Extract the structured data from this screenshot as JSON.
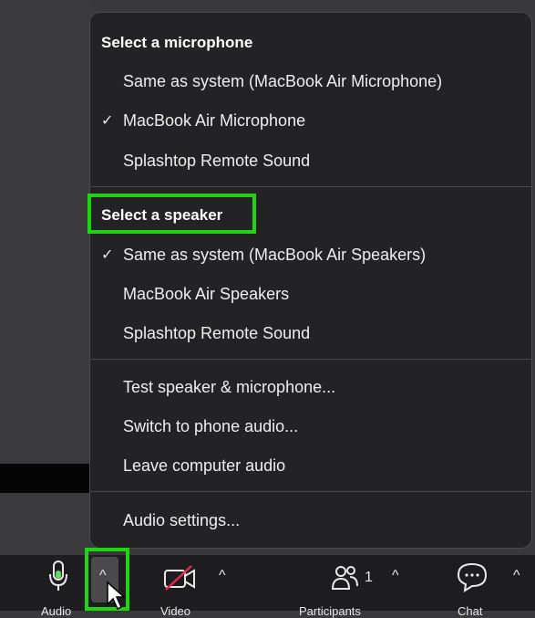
{
  "menu": {
    "microphone_title": "Select a microphone",
    "microphone_items": [
      {
        "label": "Same as system (MacBook Air Microphone)",
        "checked": false
      },
      {
        "label": "MacBook Air Microphone",
        "checked": true
      },
      {
        "label": "Splashtop Remote Sound",
        "checked": false
      }
    ],
    "speaker_title": "Select a speaker",
    "speaker_items": [
      {
        "label": "Same as system (MacBook Air Speakers)",
        "checked": true
      },
      {
        "label": "MacBook Air Speakers",
        "checked": false
      },
      {
        "label": "Splashtop Remote Sound",
        "checked": false
      }
    ],
    "actions": [
      "Test speaker & microphone...",
      "Switch to phone audio...",
      "Leave computer audio"
    ],
    "settings_label": "Audio settings...",
    "check_glyph": "✓"
  },
  "toolbar": {
    "audio_label": "Audio",
    "video_label": "Video",
    "participants_label": "Participants",
    "participants_count": "1",
    "chat_label": "Chat",
    "caret_glyph": "^"
  },
  "colors": {
    "highlight": "#1fd511",
    "menu_bg": "#232325",
    "muted_red": "#e0284d",
    "mic_green": "#5fd86a"
  }
}
